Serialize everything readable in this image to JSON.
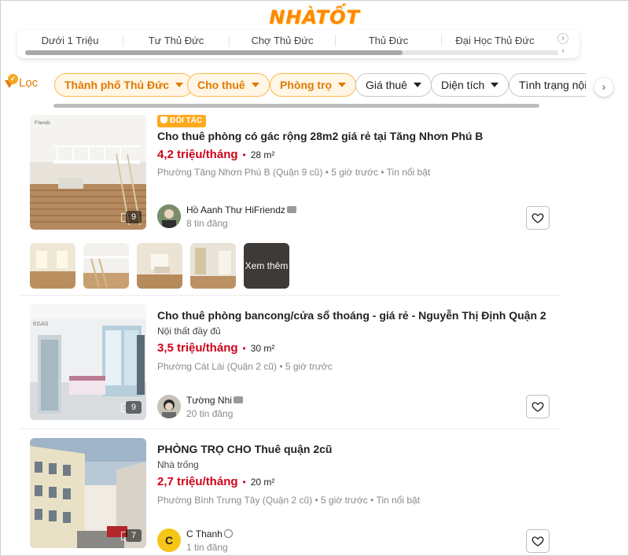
{
  "brand": {
    "logo_text": "NHÀTỐT"
  },
  "quick_chips": {
    "items": [
      "Dưới 1 Triệu",
      "Tư Thủ Đức",
      "Chợ Thủ Đức",
      "Thủ Đức",
      "Đại Học Thủ Đức"
    ]
  },
  "filters": {
    "filter_label": "Lọc",
    "active": [
      "Thành phố Thủ Đức",
      "Cho thuê",
      "Phòng trọ"
    ],
    "plain": [
      "Giá thuê",
      "Diện tích",
      "Tình trạng nội t"
    ]
  },
  "listings": [
    {
      "badge": "ĐỐI TÁC",
      "title": "Cho thuê phòng có gác rộng 28m2 giá rẻ tại Tăng Nhơn Phú B",
      "price": "4,2 triệu/tháng",
      "area": "28 m²",
      "meta": "Phường Tăng Nhơn Phú B (Quận 9 cũ) • 5 giờ trước • Tin nổi bật",
      "seller": "Hồ Aanh Thư HiFriendz",
      "seller_count": "8 tin đăng",
      "photo_count": "9",
      "see_more": "Xem thêm"
    },
    {
      "title": "Cho thuê phòng bancong/cửa sổ thoáng - giá rẻ - Nguyễn Thị Định Quận 2",
      "subtitle": "Nội thất đầy đủ",
      "price": "3,5 triệu/tháng",
      "area": "30 m²",
      "meta": "Phường Cát Lái (Quận 2 cũ) • 5 giờ trước",
      "seller": "Tường Nhi",
      "seller_count": "20 tin đăng",
      "photo_count": "9"
    },
    {
      "title": "PHÒNG TRỌ CHO Thuê quận 2cũ",
      "subtitle": "Nhà trống",
      "price": "2,7 triệu/tháng",
      "area": "20 m²",
      "meta": "Phường Bình Trưng Tây (Quận 2 cũ) • 5 giờ trước • Tin nổi bật",
      "seller": "C Thanh",
      "seller_initial": "C",
      "seller_count": "1 tin đăng",
      "photo_count": "7"
    }
  ],
  "colors": {
    "brand_orange": "#ff8800",
    "price_red": "#d0021b",
    "chip_active_border": "#ffb84d"
  }
}
